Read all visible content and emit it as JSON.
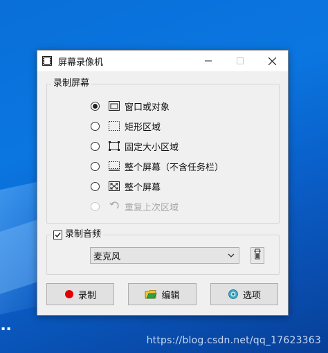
{
  "window": {
    "title": "屏幕录像机",
    "controls": {
      "minimize": "—",
      "maximize": "☐",
      "close": "✕"
    }
  },
  "record_screen": {
    "legend": "录制屏幕",
    "options": [
      {
        "label": "窗口或对象",
        "icon": "window-icon",
        "selected": true,
        "enabled": true
      },
      {
        "label": "矩形区域",
        "icon": "dotted-rect-icon",
        "selected": false,
        "enabled": true
      },
      {
        "label": "固定大小区域",
        "icon": "fixed-rect-icon",
        "selected": false,
        "enabled": true
      },
      {
        "label": "整个屏幕（不含任务栏）",
        "icon": "screen-no-taskbar-icon",
        "selected": false,
        "enabled": true
      },
      {
        "label": "整个屏幕",
        "icon": "fullscreen-icon",
        "selected": false,
        "enabled": true
      },
      {
        "label": "重复上次区域",
        "icon": "repeat-icon",
        "selected": false,
        "enabled": false
      }
    ]
  },
  "record_audio": {
    "legend": "录制音频",
    "checked": true,
    "device": "麦克风"
  },
  "buttons": {
    "record": "录制",
    "edit": "编辑",
    "options": "选项"
  },
  "watermark": "https://blog.csdn.net/qq_17623363",
  "colors": {
    "record_dot": "#e00000",
    "desktop_blue": "#0a6fd8"
  }
}
